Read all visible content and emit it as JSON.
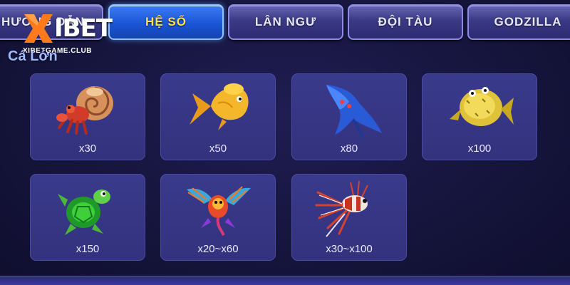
{
  "tabs": [
    {
      "label": "HƯỚNG DẪN",
      "active": false
    },
    {
      "label": "HỆ SỐ",
      "active": true
    },
    {
      "label": "LÂN NGƯ",
      "active": false
    },
    {
      "label": "ĐỘI TÀU",
      "active": false
    },
    {
      "label": "GODZILLA",
      "active": false
    }
  ],
  "logo": {
    "mark": "X",
    "word": "IBET",
    "sub": "XIBETGAME.CLUB"
  },
  "section": {
    "title": "Cá Lớn"
  },
  "colors": {
    "active_tab": "#1a55d6",
    "active_tab_text": "#ffe14a",
    "logo_x": "#ff7a1a",
    "card_bg": "#3a3a8c"
  },
  "fish": [
    {
      "icon": "hermit-crab-icon",
      "multiplier": "x30"
    },
    {
      "icon": "golden-fish-icon",
      "multiplier": "x50"
    },
    {
      "icon": "manta-ray-icon",
      "multiplier": "x80"
    },
    {
      "icon": "puffer-fish-icon",
      "multiplier": "x100"
    },
    {
      "icon": "sea-turtle-icon",
      "multiplier": "x150"
    },
    {
      "icon": "dragon-fish-icon",
      "multiplier": "x20~x60"
    },
    {
      "icon": "lionfish-icon",
      "multiplier": "x30~x100"
    }
  ]
}
